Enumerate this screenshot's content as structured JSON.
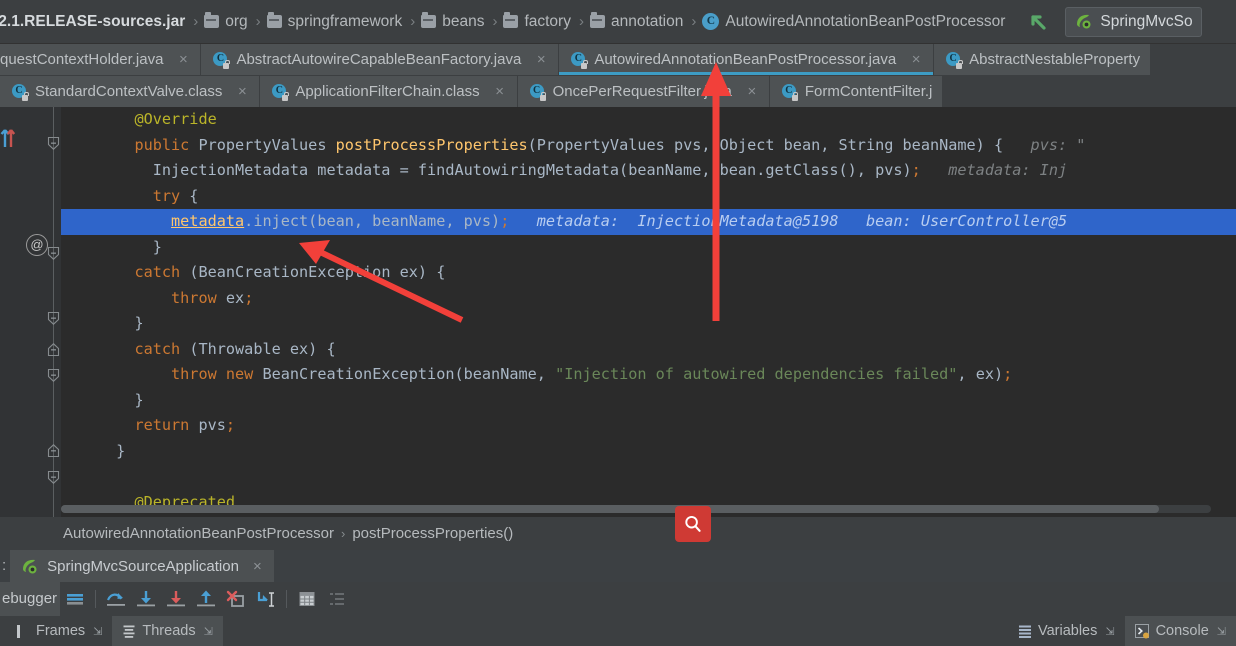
{
  "navbar": {
    "crumbs": [
      {
        "label": ".2.1.RELEASE-sources.jar",
        "icon": "jar-icon"
      },
      {
        "label": "org",
        "icon": "folder-icon"
      },
      {
        "label": "springframework",
        "icon": "folder-icon"
      },
      {
        "label": "beans",
        "icon": "folder-icon"
      },
      {
        "label": "factory",
        "icon": "folder-icon"
      },
      {
        "label": "annotation",
        "icon": "folder-icon"
      },
      {
        "label": "AutowiredAnnotationBeanPostProcessor",
        "icon": "class-icon"
      }
    ],
    "separator": "›",
    "class_glyph": "C",
    "up_arrow_icon": "green-up-arrow-icon",
    "run_config": {
      "label": "SpringMvcSo",
      "icon": "spring-boot-icon"
    }
  },
  "editor_tabs_row1": [
    {
      "label": "questContextHolder.java",
      "icon": "java-file-icon",
      "active": false,
      "close": "×"
    },
    {
      "label": "AbstractAutowireCapableBeanFactory.java",
      "icon": "java-file-icon",
      "active": false,
      "close": "×"
    },
    {
      "label": "AutowiredAnnotationBeanPostProcessor.java",
      "icon": "java-file-icon",
      "active": true,
      "close": "×"
    },
    {
      "label": "AbstractNestableProperty",
      "icon": "java-file-icon",
      "active": false,
      "close": ""
    }
  ],
  "editor_tabs_row2": [
    {
      "label": "StandardContextValve.class",
      "icon": "class-file-icon",
      "active": false,
      "close": "×"
    },
    {
      "label": "ApplicationFilterChain.class",
      "icon": "class-file-icon",
      "active": false,
      "close": "×"
    },
    {
      "label": "OncePerRequestFilter.java",
      "icon": "java-file-icon",
      "active": false,
      "close": "×"
    },
    {
      "label": "FormContentFilter.j",
      "icon": "java-file-icon",
      "active": false,
      "close": ""
    }
  ],
  "code": {
    "lines": [
      {
        "indent": 3,
        "tokens": [
          {
            "t": "@Override",
            "c": "anno"
          }
        ]
      },
      {
        "indent": 3,
        "tokens": [
          {
            "t": "public ",
            "c": "kw"
          },
          {
            "t": "PropertyValues ",
            "c": "ident"
          },
          {
            "t": "postProcessProperties",
            "c": "meth"
          },
          {
            "t": "(PropertyValues pvs, Object bean, String beanName) {",
            "c": "punc"
          },
          {
            "t": "   pvs: \"",
            "c": "hint"
          }
        ]
      },
      {
        "indent": 5,
        "tokens": [
          {
            "t": "InjectionMetadata metadata = findAutowiringMetadata(beanName, bean.getClass(), pvs)",
            "c": "ident"
          },
          {
            "t": ";",
            "c": "semi"
          },
          {
            "t": "   metadata: Inj",
            "c": "hint"
          }
        ]
      },
      {
        "indent": 5,
        "tokens": [
          {
            "t": "try ",
            "c": "kw"
          },
          {
            "t": "{",
            "c": "punc"
          }
        ]
      },
      {
        "indent": 7,
        "highlight": true,
        "tokens": [
          {
            "t": "metadata",
            "c": "sel-ident"
          },
          {
            "t": ".inject(bean, beanName, pvs)",
            "c": "ident"
          },
          {
            "t": ";",
            "c": "semi"
          },
          {
            "t": "   metadata:  InjectionMetadata@5198   bean: UserController@5",
            "c": "hint"
          }
        ]
      },
      {
        "indent": 5,
        "tokens": [
          {
            "t": "}",
            "c": "punc"
          }
        ]
      },
      {
        "indent": 3,
        "tokens": [
          {
            "t": "catch ",
            "c": "kw"
          },
          {
            "t": "(BeanCreationException ex) {",
            "c": "punc"
          }
        ]
      },
      {
        "indent": 7,
        "tokens": [
          {
            "t": "throw ",
            "c": "kw"
          },
          {
            "t": "ex",
            "c": "ident"
          },
          {
            "t": ";",
            "c": "semi"
          }
        ]
      },
      {
        "indent": 3,
        "tokens": [
          {
            "t": "}",
            "c": "punc"
          }
        ]
      },
      {
        "indent": 3,
        "tokens": [
          {
            "t": "catch ",
            "c": "kw"
          },
          {
            "t": "(Throwable ex) {",
            "c": "punc"
          }
        ]
      },
      {
        "indent": 7,
        "tokens": [
          {
            "t": "throw ",
            "c": "kw"
          },
          {
            "t": "new ",
            "c": "kw"
          },
          {
            "t": "BeanCreationException(beanName, ",
            "c": "ident"
          },
          {
            "t": "\"Injection of autowired dependencies failed\"",
            "c": "str"
          },
          {
            "t": ", ex)",
            "c": "ident"
          },
          {
            "t": ";",
            "c": "semi"
          }
        ]
      },
      {
        "indent": 3,
        "tokens": [
          {
            "t": "}",
            "c": "punc"
          }
        ]
      },
      {
        "indent": 3,
        "tokens": [
          {
            "t": "return ",
            "c": "kw"
          },
          {
            "t": "pvs",
            "c": "ident"
          },
          {
            "t": ";",
            "c": "semi"
          }
        ]
      },
      {
        "indent": 1,
        "tokens": [
          {
            "t": "}",
            "c": "punc"
          }
        ]
      },
      {
        "indent": 0,
        "tokens": []
      },
      {
        "indent": 3,
        "tokens": [
          {
            "t": "@Deprecated",
            "c": "anno"
          }
        ]
      }
    ],
    "caret_marker": "@"
  },
  "breadcrumb_bottom": {
    "items": [
      "AutowiredAnnotationBeanPostProcessor",
      "postProcessProperties()"
    ],
    "separator": "›"
  },
  "search_fab": {
    "icon": "search-icon",
    "color": "#cf3a34"
  },
  "debug_panel": {
    "colon": ":",
    "session_tab": {
      "label": "SpringMvcSourceApplication",
      "icon": "spring-boot-icon",
      "close": "×"
    },
    "toolbar_label": "ebugger",
    "toolbar_buttons": [
      {
        "name": "show-execution-point-icon",
        "title": "Show Execution Point"
      },
      {
        "name": "step-over-icon",
        "title": "Step Over"
      },
      {
        "name": "step-into-icon",
        "title": "Step Into"
      },
      {
        "name": "force-step-into-icon",
        "title": "Force Step Into"
      },
      {
        "name": "step-out-icon",
        "title": "Step Out"
      },
      {
        "name": "drop-frame-icon",
        "title": "Drop Frame"
      },
      {
        "name": "run-to-cursor-icon",
        "title": "Run to Cursor"
      },
      {
        "name": "evaluate-expression-icon",
        "title": "Evaluate Expression"
      },
      {
        "name": "settings-list-icon",
        "title": "Layout Settings"
      }
    ]
  },
  "bottom_tabs": [
    {
      "label": "Frames",
      "icon": "frames-icon",
      "pin": "⇲",
      "selected": false
    },
    {
      "label": "Threads",
      "icon": "threads-icon",
      "pin": "⇲",
      "selected": true
    },
    {
      "label": "Variables",
      "icon": "variables-icon",
      "pin": "⇲",
      "selected": false
    },
    {
      "label": "Console",
      "icon": "console-icon",
      "pin": "⇲",
      "selected": true
    }
  ],
  "colors": {
    "accent_tab_underline": "#3d9cc4",
    "highlight_line": "#2f65ca",
    "editor_bg": "#2b2b2b",
    "chrome_bg": "#3c3f41",
    "annotation_arrow": "#f2403a",
    "search_fab": "#cf3a34"
  }
}
